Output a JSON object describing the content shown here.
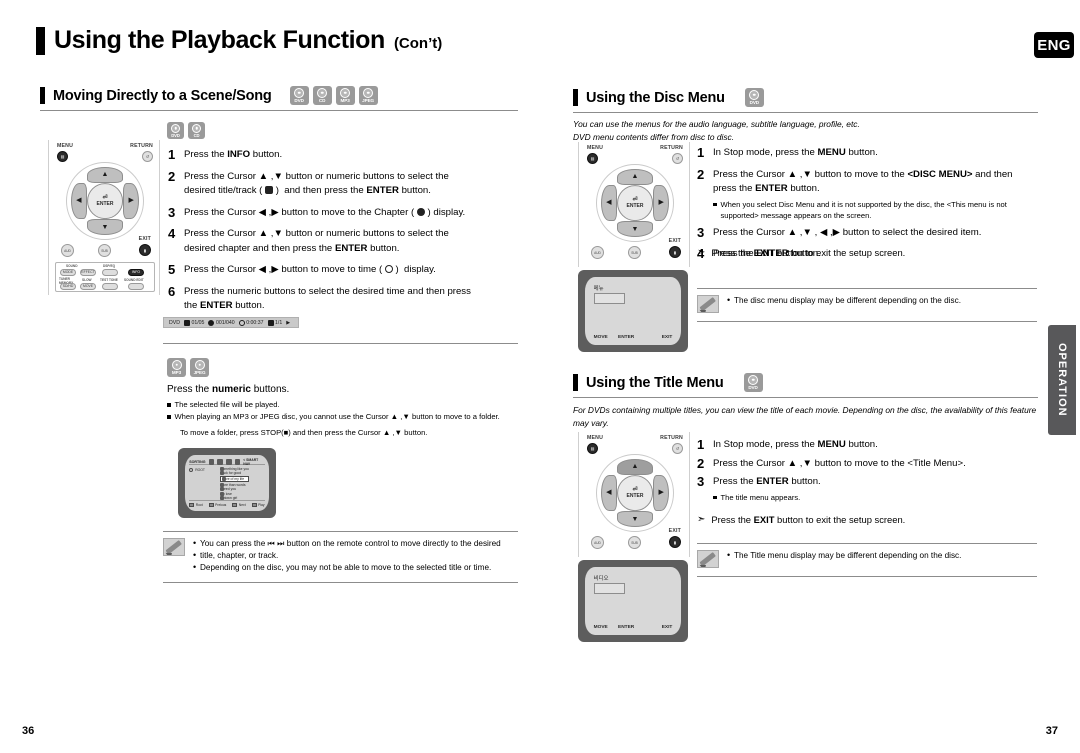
{
  "page": {
    "title": "Using the Playback Function",
    "title_cont": "(Con’t)",
    "lang_badge": "ENG",
    "side_tab": "OPERATION",
    "page_number_left": "36",
    "page_number_right": "37"
  },
  "left_column": {
    "section": {
      "heading": "Moving Directly to a Scene/Song",
      "disc_icons": [
        "DVD",
        "CD",
        "MP3",
        "JPEG"
      ]
    },
    "dvd_cd_icons": [
      "DVD",
      "CD"
    ],
    "steps": [
      {
        "n": "1",
        "lines": [
          "Press the INFO button."
        ]
      },
      {
        "n": "2",
        "lines": [
          "Press the Cursor ▲ ,▼ button or numeric buttons to select the",
          "desired title/track (  ) and then press the ENTER button."
        ]
      },
      {
        "n": "3",
        "lines": [
          "Press the Cursor ◀ ,▶ button to move to the Chapter (  ) display."
        ]
      },
      {
        "n": "4",
        "lines": [
          "Press the Cursor ▲ ,▼ button or numeric buttons to select the",
          "desired chapter and then press the ENTER button."
        ]
      },
      {
        "n": "5",
        "lines": [
          "Press the Cursor ◀ ,▶ button to move to time (  )  display."
        ]
      },
      {
        "n": "6",
        "lines": [
          "Press the numeric buttons to select the desired time and then press",
          "the ENTER button."
        ]
      }
    ],
    "status_bar": {
      "disc": "DVD",
      "title": "01/05",
      "chapter": "001/040",
      "time": "0:00:37",
      "audio": "1/1"
    },
    "mp3_jpeg_icons": [
      "MP3",
      "JPEG"
    ],
    "mp3_instruction": "Press the numeric buttons.",
    "mp3_substeps": [
      "The selected file will be played.",
      "When playing an MP3 or JPEG disc, you cannot use the Cursor ▲ ,▼  button to move to a folder."
    ],
    "mp3_substep_cont": "To move a folder, press STOP(■) and then press the Cursor ▲ ,▼ button.",
    "file_browser": {
      "header_label": "SORTING",
      "smart_nav": "< SMART NAV",
      "root_label": "ROOT",
      "tracks": [
        "Something like you",
        "Back for good",
        "Love of my life",
        "More than words",
        "I need you",
        "My love",
        "Uptown girl"
      ],
      "selected_track": "Love of my life",
      "footer_buttons": [
        "Root",
        "Preious",
        "Next",
        "Play"
      ]
    },
    "note": [
      "You can press the ⏮ ⏭ button on the remote control to move directly to the desired",
      "title, chapter, or track.",
      "Depending on the disc, you may not be able to move to the selected title or time."
    ]
  },
  "right_column": {
    "disc_menu": {
      "heading": "Using the Disc Menu",
      "disc_icons": [
        "DVD"
      ],
      "intro": [
        "You can use the menus for the audio language, subtitle language, profile, etc.",
        "DVD menu contents differ from disc to disc."
      ],
      "steps": [
        {
          "n": "1",
          "lines": [
            "In Stop mode, press the MENU button."
          ]
        },
        {
          "n": "2",
          "lines": [
            "Press the Cursor ▲ ,▼ button to move to the <DISC MENU> and then",
            "press the ENTER button."
          ]
        },
        {
          "n": "3",
          "lines": [
            "Press the Cursor ▲ ,▼ , ◀ ,▶ button to select the desired item."
          ]
        },
        {
          "n": "4",
          "lines": [
            "Press the ENTER button."
          ]
        }
      ],
      "substep": [
        "When you select Disc Menu and it is not supported by the disc, the <This menu is not",
        "supported> message appears on the screen."
      ],
      "exit_note": "Press the EXIT button to exit the setup screen.",
      "note": [
        "The disc menu display may be different depending on the disc."
      ],
      "tv_screen": {
        "osd_title": "메뉴",
        "buttons": [
          "MOVE",
          "ENTER",
          "EXIT"
        ]
      }
    },
    "title_menu": {
      "heading": "Using the Title Menu",
      "disc_icons": [
        "DVD"
      ],
      "intro": [
        "For DVDs containing multiple titles, you can view the title of each movie. Depending on the disc, the availability of this feature",
        "may vary."
      ],
      "steps": [
        {
          "n": "1",
          "lines": [
            "In Stop mode, press the MENU button."
          ]
        },
        {
          "n": "2",
          "lines": [
            "Press the Cursor ▲ ,▼ button to move to the <Title Menu>."
          ]
        },
        {
          "n": "3",
          "lines": [
            "Press the ENTER button."
          ]
        }
      ],
      "substep": [
        "The title menu appears."
      ],
      "exit_note": "Press the EXIT button to exit the setup screen.",
      "note": [
        "The Title menu display may be different depending on the disc."
      ],
      "tv_screen": {
        "osd_title": "비디오",
        "buttons": [
          "MOVE",
          "ENTER",
          "EXIT"
        ]
      }
    }
  },
  "remote": {
    "menu_label": "MENU",
    "return_label": "RETURN",
    "exit_label": "EXIT",
    "enter_label": "ENTER",
    "audio_label": "AUDIO",
    "subtitle_label": "SUB TITLE",
    "left_keys": {
      "row_labels": [
        "SOUND",
        "DSP/EQ",
        "SLOW",
        "TEST TONE",
        "SOUND EDIT"
      ],
      "buttons": [
        "MODE",
        "EFFECT",
        "INFO",
        "TUNER MEMORY",
        "SD/HD"
      ],
      "highlight": "INFO"
    }
  }
}
